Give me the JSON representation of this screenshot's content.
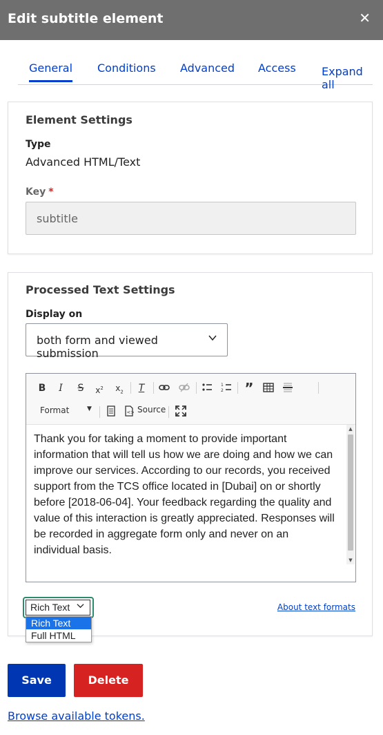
{
  "dialog": {
    "title": "Edit subtitle element",
    "close_glyph": "✕"
  },
  "tabs": [
    {
      "label": "General",
      "active": true
    },
    {
      "label": "Conditions",
      "active": false
    },
    {
      "label": "Advanced",
      "active": false
    },
    {
      "label": "Access",
      "active": false
    }
  ],
  "expand_all": "Expand all",
  "element_settings": {
    "title": "Element Settings",
    "type_label": "Type",
    "type_value": "Advanced HTML/Text",
    "key_label": "Key",
    "key_required": "*",
    "key_value": "subtitle"
  },
  "processed_text": {
    "title": "Processed Text Settings",
    "display_on_label": "Display on",
    "display_on_value": "both form and viewed submission",
    "toolbar": {
      "format_label": "Format",
      "source_label": "Source"
    },
    "content": "Thank you for taking a moment to provide important information that will tell us how we are doing and how we can improve our services. According to our records, you received support from the TCS office located in [Dubai] on or shortly before [2018-06-04]. Your feedback regarding the quality and value of this interaction is greatly appreciated. Responses will be recorded in aggregate form only and never on an individual basis.",
    "text_format": {
      "selected": "Rich Text",
      "options": [
        "Rich Text",
        "Full HTML"
      ]
    },
    "about_link": "About text formats"
  },
  "actions": {
    "save_label": "Save",
    "delete_label": "Delete",
    "tokens_link": "Browse available tokens."
  },
  "colors": {
    "titlebar": "#6f6f6f",
    "accent_blue": "#003ecc",
    "save": "#0036b1",
    "delete": "#d72222",
    "focus_ring": "#2a8c6c"
  }
}
